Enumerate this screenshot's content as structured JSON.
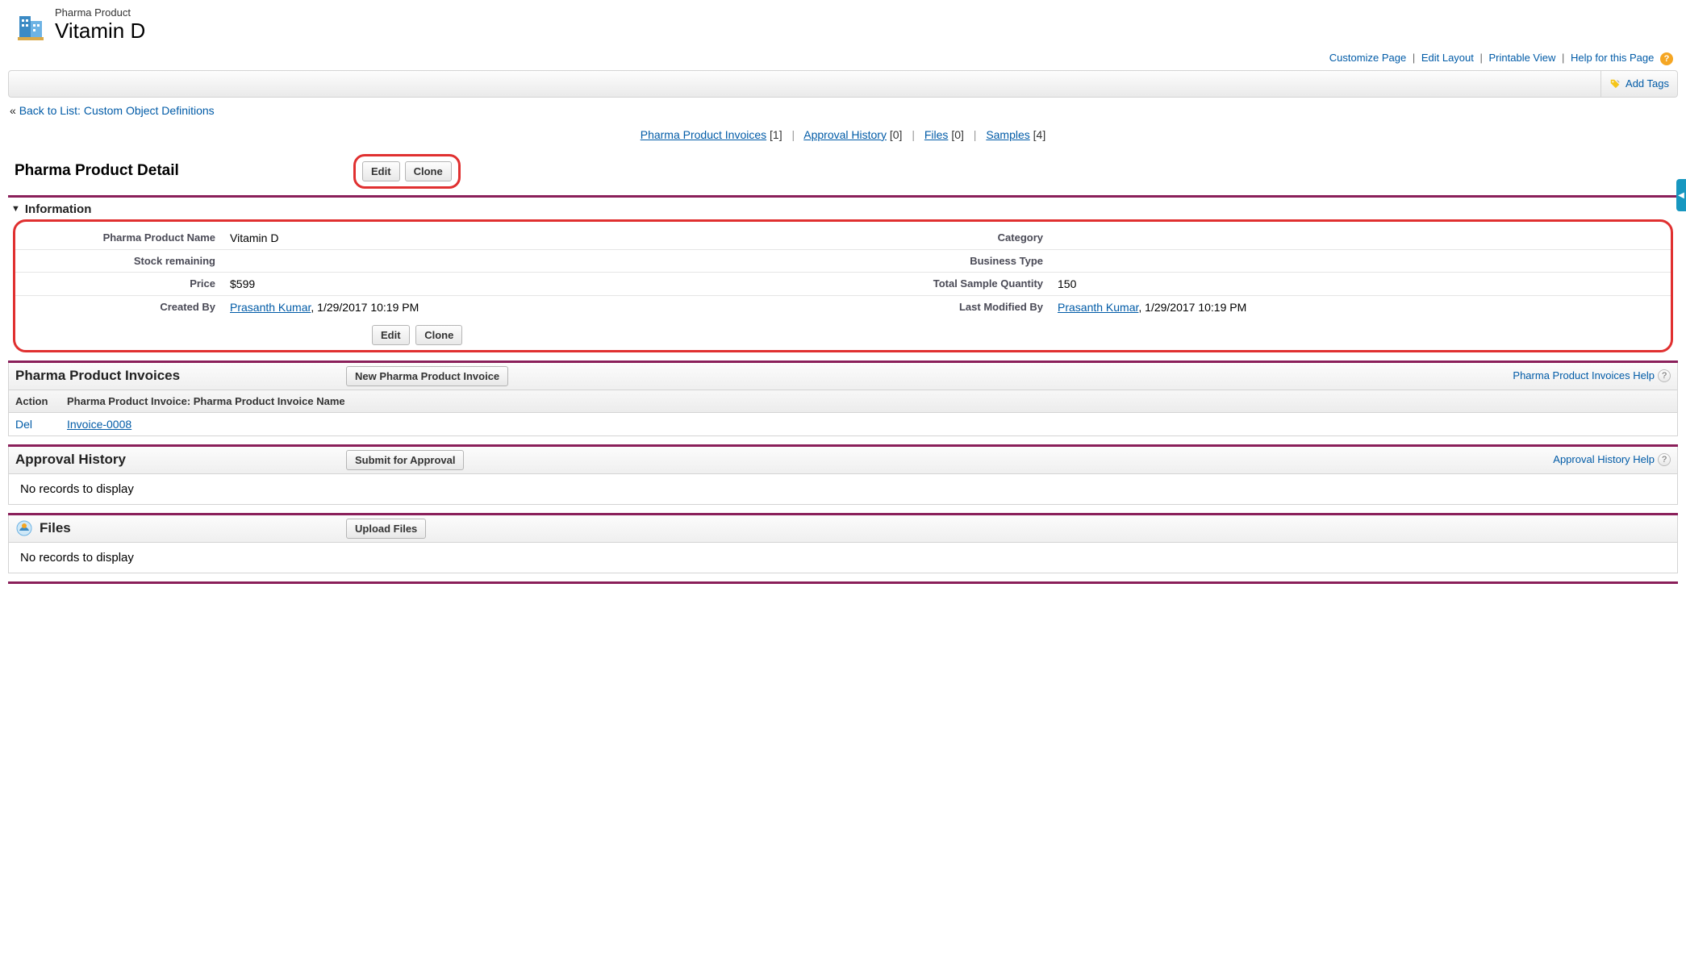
{
  "header": {
    "object_type": "Pharma Product",
    "record_name": "Vitamin D"
  },
  "top_links": {
    "customize": "Customize Page",
    "edit_layout": "Edit Layout",
    "printable": "Printable View",
    "help": "Help for this Page"
  },
  "tag_bar": {
    "add_tags": "Add Tags"
  },
  "back_link": {
    "prefix": "« ",
    "label": "Back to List: Custom Object Definitions"
  },
  "related_nav": {
    "items": [
      {
        "label": "Pharma Product Invoices",
        "count": "[1]"
      },
      {
        "label": "Approval History",
        "count": "[0]"
      },
      {
        "label": "Files",
        "count": "[0]"
      },
      {
        "label": "Samples",
        "count": "[4]"
      }
    ]
  },
  "detail": {
    "title": "Pharma Product Detail",
    "edit": "Edit",
    "clone": "Clone",
    "section_label": "Information",
    "fields": {
      "name_label": "Pharma Product Name",
      "name_value": "Vitamin D",
      "category_label": "Category",
      "category_value": "",
      "stock_label": "Stock remaining",
      "stock_value": "",
      "biztype_label": "Business Type",
      "biztype_value": "",
      "price_label": "Price",
      "price_value": "$599",
      "tsq_label": "Total Sample Quantity",
      "tsq_value": "150",
      "created_label": "Created By",
      "created_user": "Prasanth Kumar",
      "created_rest": ", 1/29/2017 10:19 PM",
      "modified_label": "Last Modified By",
      "modified_user": "Prasanth Kumar",
      "modified_rest": ", 1/29/2017 10:19 PM"
    }
  },
  "related_invoices": {
    "title": "Pharma Product Invoices",
    "new_btn": "New Pharma Product Invoice",
    "help": "Pharma Product Invoices Help",
    "col_action": "Action",
    "col_name": "Pharma Product Invoice: Pharma Product Invoice Name",
    "rows": [
      {
        "action": "Del",
        "name": "Invoice-0008"
      }
    ]
  },
  "related_approval": {
    "title": "Approval History",
    "submit_btn": "Submit for Approval",
    "help": "Approval History Help",
    "no_records": "No records to display"
  },
  "related_files": {
    "title": "Files",
    "upload_btn": "Upload Files",
    "no_records": "No records to display"
  }
}
